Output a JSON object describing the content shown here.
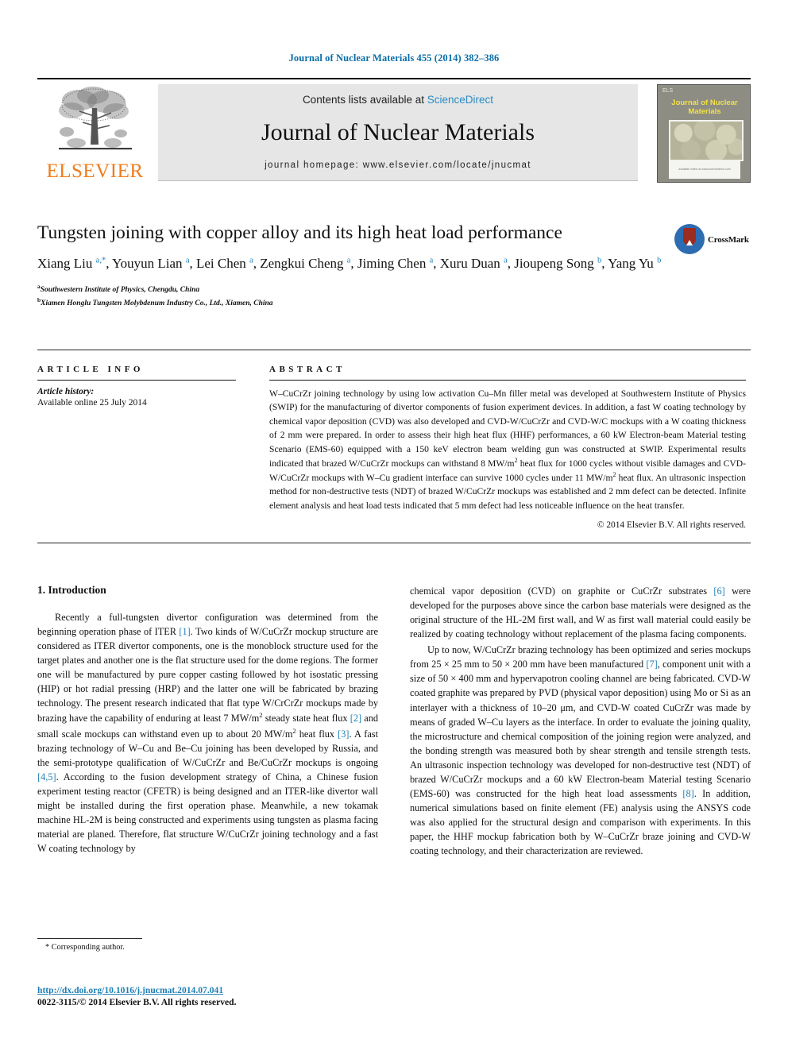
{
  "running_head": "Journal of Nuclear Materials 455 (2014) 382–386",
  "masthead": {
    "publisher_wordmark": "ELSEVIER",
    "contents_prefix": "Contents lists available at ",
    "contents_link": "ScienceDirect",
    "journal_title": "Journal of Nuclear Materials",
    "homepage": "journal homepage: www.elsevier.com/locate/jnucmat",
    "cover": {
      "publisher_mark": "ELS",
      "title": "Journal of Nuclear Materials",
      "footer": "available online at www.sciencedirect.com"
    }
  },
  "article": {
    "title": "Tungsten joining with copper alloy and its high heat load performance",
    "crossmark_label": "CrossMark",
    "authors_html": "Xiang Liu <sup>a,*</sup>, Youyun Lian <sup>a</sup>, Lei Chen <sup>a</sup>, Zengkui Cheng <sup>a</sup>, Jiming Chen <sup>a</sup>, Xuru Duan <sup>a</sup>, Jioupeng Song <sup>b</sup>, Yang Yu <sup>b</sup>",
    "affiliations": [
      {
        "marker": "a",
        "text": "Southwestern Institute of Physics, Chengdu, China"
      },
      {
        "marker": "b",
        "text": "Xiamen Honglu Tungsten Molybdenum Industry Co., Ltd., Xiamen, China"
      }
    ]
  },
  "article_info": {
    "heading": "ARTICLE INFO",
    "history_label": "Article history:",
    "history_value": "Available online 25 July 2014"
  },
  "abstract": {
    "heading": "ABSTRACT",
    "body_html": "W–CuCrZr joining technology by using low activation Cu–Mn filler metal was developed at Southwestern Institute of Physics (SWIP) for the manufacturing of divertor components of fusion experiment devices. In addition, a fast W coating technology by chemical vapor deposition (CVD) was also developed and CVD-W/CuCrZr and CVD-W/C mockups with a W coating thickness of 2 mm were prepared. In order to assess their high heat flux (HHF) performances, a 60 kW Electron-beam Material testing Scenario (EMS-60) equipped with a 150 keV electron beam welding gun was constructed at SWIP. Experimental results indicated that brazed W/CuCrZr mockups can withstand 8 MW/m<sup>2</sup> heat flux for 1000 cycles without visible damages and CVD-W/CuCrZr mockups with W–Cu gradient interface can survive 1000 cycles under 11 MW/m<sup>2</sup> heat flux. An ultrasonic inspection method for non-destructive tests (NDT) of brazed W/CuCrZr mockups was established and 2 mm defect can be detected. Infinite element analysis and heat load tests indicated that 5 mm defect had less noticeable influence on the heat transfer.",
    "copyright": "© 2014 Elsevier B.V. All rights reserved."
  },
  "body": {
    "section_heading": "1. Introduction",
    "left_paragraphs_html": [
      "Recently a full-tungsten divertor configuration was determined from the beginning operation phase of ITER <span class=\"ref\">[1]</span>. Two kinds of W/CuCrZr mockup structure are considered as ITER divertor components, one is the monoblock structure used for the target plates and another one is the flat structure used for the dome regions. The former one will be manufactured by pure copper casting followed by hot isostatic pressing (HIP) or hot radial pressing (HRP) and the latter one will be fabricated by brazing technology. The present research indicated that flat type W/CrCrZr mockups made by brazing have the capability of enduring at least 7 MW/m<sup>2</sup> steady state heat flux <span class=\"ref\">[2]</span> and small scale mockups can withstand even up to about 20 MW/m<sup>2</sup> heat flux <span class=\"ref\">[3]</span>. A fast brazing technology of W–Cu and Be–Cu joining has been developed by Russia, and the semi-prototype qualification of W/CuCrZr and Be/CuCrZr mockups is ongoing <span class=\"ref\">[4,5]</span>. According to the fusion development strategy of China, a Chinese fusion experiment testing reactor (CFETR) is being designed and an ITER-like divertor wall might be installed during the first operation phase. Meanwhile, a new tokamak machine HL-2M is being constructed and experiments using tungsten as plasma facing material are planed. Therefore, flat structure W/CuCrZr joining technology and a fast W coating technology by"
    ],
    "right_paragraphs_html": [
      "chemical vapor deposition (CVD) on graphite or CuCrZr substrates <span class=\"ref\">[6]</span> were developed for the purposes above since the carbon base materials were designed as the original structure of the HL-2M first wall, and W as first wall material could easily be realized by coating technology without replacement of the plasma facing components.",
      "Up to now, W/CuCrZr brazing technology has been optimized and series mockups from 25 × 25 mm to 50 × 200 mm have been manufactured <span class=\"ref\">[7]</span>, component unit with a size of 50 × 400 mm and hypervapotron cooling channel are being fabricated. CVD-W coated graphite was prepared by PVD (physical vapor deposition) using Mo or Si as an interlayer with a thickness of 10–20 μm, and CVD-W coated CuCrZr was made by means of graded W–Cu layers as the interface. In order to evaluate the joining quality, the microstructure and chemical composition of the joining region were analyzed, and the bonding strength was measured both by shear strength and tensile strength tests. An ultrasonic inspection technology was developed for non-destructive test (NDT) of brazed W/CuCrZr mockups and a 60 kW Electron-beam Material testing Scenario (EMS-60) was constructed for the high heat load assessments <span class=\"ref\">[8]</span>. In addition, numerical simulations based on finite element (FE) analysis using the ANSYS code was also applied for the structural design and comparison with experiments. In this paper, the HHF mockup fabrication both by W–CuCrZr braze joining and CVD-W coating technology, and their characterization are reviewed."
    ],
    "footnote": "* Corresponding author."
  },
  "page_footer": {
    "doi": "http://dx.doi.org/10.1016/j.jnucmat.2014.07.041",
    "issn_line": "0022-3115/© 2014 Elsevier B.V. All rights reserved."
  },
  "colors": {
    "link_blue": "#1f7fb5",
    "sciencedirect_blue": "#2a8bc4",
    "elsevier_orange": "#f07c1a",
    "masthead_grey": "#e6e6e6"
  }
}
